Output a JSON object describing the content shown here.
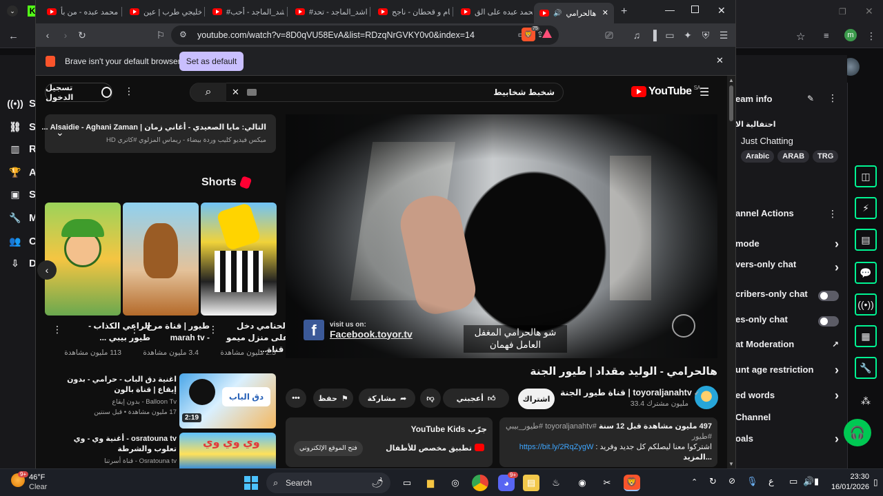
{
  "background": {
    "left_nav": [
      {
        "icon": "broadcast-icon",
        "label": "S"
      },
      {
        "icon": "link-icon",
        "label": "S"
      },
      {
        "icon": "chart-icon",
        "label": "R"
      },
      {
        "icon": "trophy-icon",
        "label": "A"
      },
      {
        "icon": "stream-icon",
        "label": "S"
      },
      {
        "icon": "wrench-icon",
        "label": "M"
      },
      {
        "icon": "people-icon",
        "label": "C"
      },
      {
        "icon": "download-icon",
        "label": "D"
      }
    ],
    "right_panel": {
      "stream_info_title": "eam info",
      "stream_title": "احتفالية الا",
      "category": "Just Chatting",
      "tags": [
        "Arabic",
        "ARAB",
        "TRG"
      ],
      "channel_actions_title": "annel Actions",
      "rows": [
        {
          "label": "mode",
          "control": "chevron"
        },
        {
          "label": "vers-only chat",
          "control": "chevron"
        },
        {
          "label": "cribers-only chat",
          "control": "toggle"
        },
        {
          "label": "es-only chat",
          "control": "toggle"
        },
        {
          "label": "at Moderation",
          "control": "external"
        },
        {
          "label": "unt age restriction",
          "control": "chevron"
        },
        {
          "label": "ed words",
          "control": "chevron"
        },
        {
          "label": "Channel",
          "control": "none"
        },
        {
          "label": "oals",
          "control": "chevron"
        }
      ]
    }
  },
  "browser": {
    "tabs": [
      {
        "label": "محمد عبده - من بأ"
      },
      {
        "label": "خليجي طرب | عين"
      },
      {
        "label": "#راشد_الماجد - أحب"
      },
      {
        "label": "#راشد_الماجد - تحد"
      },
      {
        "label": "يام و قحطان - ناجح"
      },
      {
        "label": "محمد عبده على الق"
      },
      {
        "label": "هالحرامي",
        "active": true
      }
    ],
    "url": "youtube.com/watch?v=8D0qVU58EvA&list=RDzqNrGVKY0v0&index=14",
    "brave_badge": "75",
    "infobar": {
      "message": "Brave isn't your default browser",
      "button": "Set as default"
    }
  },
  "youtube": {
    "signin_label": "تسجيل الدخول",
    "search_query": "شخبط شخابيط",
    "logo_text": "YouTube",
    "logo_region": "SA",
    "up_next": {
      "line1": "التالي: مايا الصعيدي - أغاني زمان | Alsaidie - Aghani Zaman ...",
      "line2": "ميكس فيديو كليب وردة بيضاء - ريماس المزلوي #كاتري HD"
    },
    "shorts_title": "Shorts",
    "shorts": [
      {
        "title": "الراعي الكذاب - طيور بيبي ...",
        "views": "113 مليون مشاهدة"
      },
      {
        "title": "طيور | قناة مرح - marah tv",
        "views": "3.4 مليون مشاهدة"
      },
      {
        "title": "الحنامي دخل على منزل ميمو | قناة...",
        "views": "2.5 مليون مشاهدة"
      }
    ],
    "related": [
      {
        "title": "اغنية دق الباب - حرامي - بدون إيقاع | قناة بالون",
        "channel": "Balloon Tv - بدون إيقاع",
        "meta": "17 مليون مشاهدة • قبل سنتين",
        "duration": "2:19"
      },
      {
        "title": "osratouna tv - أغنية وي - وي تعلوب والشرطة",
        "channel": "Osratouna tv - قناة أسرتنا",
        "meta": "",
        "duration": ""
      }
    ],
    "video": {
      "overlay_link": "Facebook.toyor.tv",
      "overlay_pre": "visit us on:",
      "caption": "شو هالحرامي المغفل العامل فهمان",
      "title": "هالحرامي - الوليد مقداد | طيور الجنة",
      "channel": "قناة طيور الجنة | toyoraljanahtv",
      "subscribers": "33.4 مليون مشترك",
      "subscribe_label": "اشتراك",
      "like_label": "أعجبني",
      "share_label": "مشاركة",
      "save_label": "حفظ",
      "description": {
        "stats": "497 مليون مشاهدة  قبل 12 سنة",
        "tags": "#toyoraljanahtv #طيور_بيبي #طيور",
        "text": "اشتركوا معنا ليصلكم كل جديد وفريد : ",
        "link": "https://bit.ly/2RqZygW",
        "more": "...المزيد"
      },
      "kids_promo": {
        "title": "جرّب YouTube Kids",
        "subtitle": "تطبيق مخصص للأطفال",
        "button": "فتح الموقع الإلكتروني"
      }
    }
  },
  "taskbar": {
    "weather_temp": "46°F",
    "weather_desc": "Clear",
    "weather_badge": "9+",
    "search_label": "Search",
    "language": "ع",
    "time": "23:30",
    "date": "16/01/2026"
  }
}
